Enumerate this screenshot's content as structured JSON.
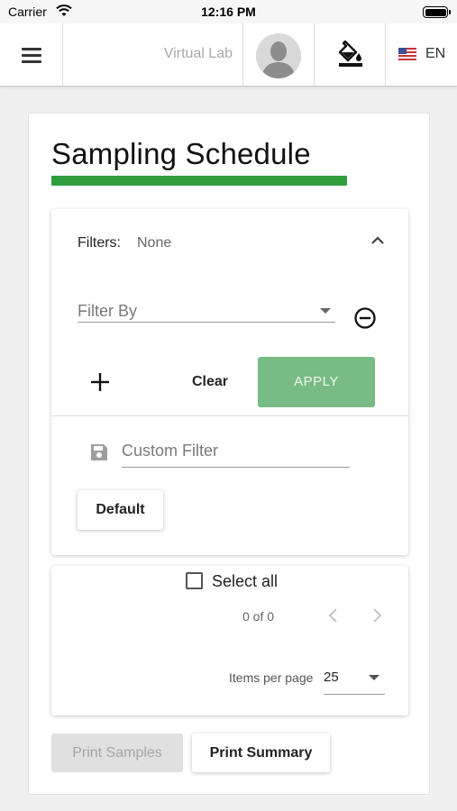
{
  "status_bar": {
    "carrier": "Carrier",
    "time": "12:16 PM"
  },
  "toolbar": {
    "title": "Virtual Lab",
    "language": "EN",
    "icons": [
      "menu-icon",
      "avatar",
      "format-color-fill-icon",
      "us-flag-icon"
    ]
  },
  "page": {
    "title": "Sampling Schedule",
    "accent_color": "#2e9e3f"
  },
  "filters": {
    "label": "Filters:",
    "value": "None",
    "filter_by_placeholder": "Filter By",
    "clear_label": "Clear",
    "apply_label": "APPLY",
    "apply_color": "#79bb84",
    "custom_filter_placeholder": "Custom Filter",
    "default_label": "Default"
  },
  "results": {
    "select_all_label": "Select all",
    "paging_text": "0 of 0",
    "items_per_page_label": "Items per page",
    "items_per_page_value": "25"
  },
  "actions": {
    "print_samples_label": "Print Samples",
    "print_summary_label": "Print Summary"
  }
}
